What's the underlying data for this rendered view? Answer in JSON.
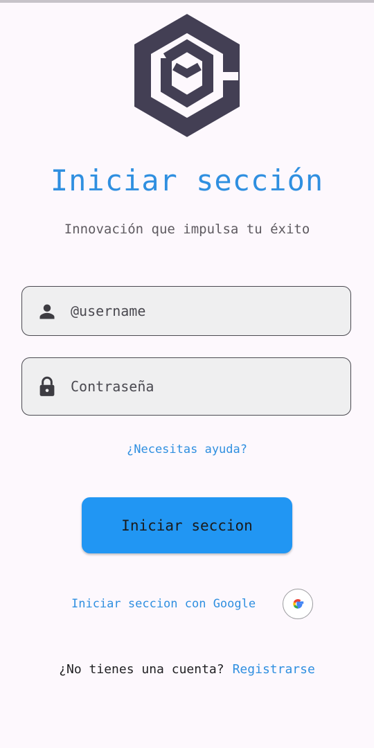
{
  "title": "Iniciar sección",
  "subtitle": "Innovación que impulsa tu éxito",
  "username_field": {
    "placeholder": "@username",
    "value": "",
    "icon": "person-icon"
  },
  "password_field": {
    "placeholder": "Contraseña",
    "value": "",
    "icon": "lock-icon"
  },
  "help_link": "¿Necesitas ayuda?",
  "login_button": "Iniciar seccion",
  "google": {
    "label": "Iniciar seccion con Google",
    "icon": "google-icon"
  },
  "register": {
    "question": "¿No tienes una cuenta?",
    "link": "Registrarse"
  },
  "colors": {
    "accent": "#2196f3",
    "link": "#2f8fe0",
    "logo": "#433f54",
    "background": "#fdf8fd",
    "field_background": "#efeff0"
  }
}
